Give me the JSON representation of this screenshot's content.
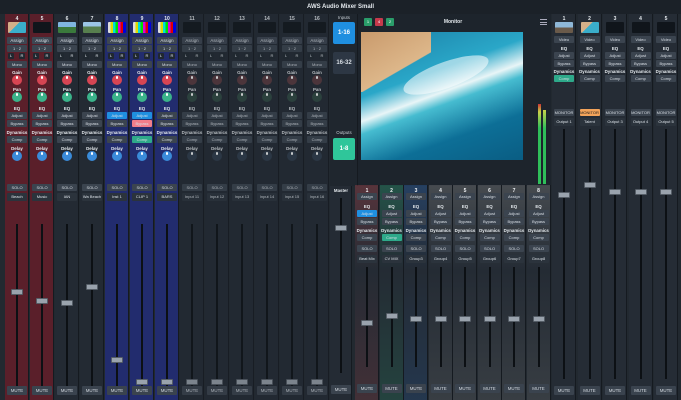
{
  "title": "AWS Audio Mixer Small",
  "colors": {
    "accent": "#2ea8d9",
    "red": "#d64553",
    "green": "#3ab38a",
    "blue": "#3a8bd9",
    "orange": "#f2a35a"
  },
  "common": {
    "assign": "Assign",
    "eq": "EQ",
    "adjust": "Adjust",
    "bypass": "Bypass",
    "dynamics": "Dynamics",
    "comp": "Comp",
    "gain": "Gain",
    "pan": "Pan",
    "delay": "Delay",
    "solo": "SOLO",
    "mute": "MUTE",
    "mono": "Mono",
    "l": "L",
    "r": "R",
    "route": "1 · 2",
    "video": "Video",
    "monitor": "MONITOR",
    "master": "Master",
    "outputs": "Outputs",
    "inputs_label": "Inputs"
  },
  "input_strips": [
    {
      "num": "4",
      "name": "Beach",
      "thumb": "beach",
      "bg": "#5a1f2a"
    },
    {
      "num": "5",
      "name": "Music",
      "thumb": "",
      "bg": "#5a1f2a"
    },
    {
      "num": "6",
      "name": "IAN",
      "thumb": "landscape",
      "bg": "#232a33"
    },
    {
      "num": "7",
      "name": "Wa Beach",
      "thumb": "landscape2",
      "bg": "#232a33"
    },
    {
      "num": "8",
      "name": "Inst 1",
      "thumb": "colorbars",
      "bg": "#222c6e"
    },
    {
      "num": "9",
      "name": "CLIP 1",
      "thumb": "colorbars",
      "bg": "#222c6e"
    },
    {
      "num": "10",
      "name": "BARS",
      "thumb": "colorbars",
      "bg": "#222c6e"
    },
    {
      "num": "11",
      "name": "Input 11",
      "thumb": "",
      "bg": "#232a33"
    },
    {
      "num": "12",
      "name": "Input 12",
      "thumb": "",
      "bg": "#232a33"
    },
    {
      "num": "13",
      "name": "Input 13",
      "thumb": "",
      "bg": "#232a33"
    },
    {
      "num": "14",
      "name": "Input 14",
      "thumb": "",
      "bg": "#232a33"
    },
    {
      "num": "15",
      "name": "Input 15",
      "thumb": "",
      "bg": "#232a33"
    },
    {
      "num": "16",
      "name": "Input 16",
      "thumb": "",
      "bg": "#232a33"
    }
  ],
  "bank": {
    "inputs_1_16": "1-16",
    "inputs_16_32": "16-32",
    "outputs_1_8": "1-8"
  },
  "monitor": {
    "label": "Monitor",
    "tags": [
      "1",
      "4",
      "2"
    ]
  },
  "mix_strips": [
    {
      "num": "1",
      "name": "Beat Mix",
      "color": "#c34a52"
    },
    {
      "num": "2",
      "name": "CV MIX",
      "color": "#2aa97a"
    },
    {
      "num": "3",
      "name": "Group3",
      "color": "#2f6fc4"
    },
    {
      "num": "4",
      "name": "Group4",
      "color": "#8f8f8f"
    },
    {
      "num": "5",
      "name": "Group5",
      "color": "#8f8f8f"
    },
    {
      "num": "6",
      "name": "Group6",
      "color": "#8f8f8f"
    },
    {
      "num": "7",
      "name": "Group7",
      "color": "#8f8f8f"
    },
    {
      "num": "8",
      "name": "Group8",
      "color": "#8f8f8f"
    }
  ],
  "output_strips": [
    {
      "num": "1",
      "name": "Output 1",
      "thumb": "monitor"
    },
    {
      "num": "2",
      "name": "Talent",
      "thumb": "beach"
    },
    {
      "num": "3",
      "name": "Output 3",
      "thumb": ""
    },
    {
      "num": "4",
      "name": "Output 4",
      "thumb": ""
    },
    {
      "num": "5",
      "name": "Output 5",
      "thumb": ""
    }
  ],
  "fader_levels": {
    "inputs": [
      0.58,
      0.52,
      0.51,
      0.61,
      0.14,
      0.0,
      0.0,
      0.0,
      0.0,
      0.0,
      0.0,
      0.0,
      0.0
    ],
    "master": 0.84,
    "mix": [
      0.47,
      0.54,
      0.51,
      0.51,
      0.51,
      0.51,
      0.51,
      0.51
    ],
    "outputs": [
      0.75,
      0.79,
      0.76,
      0.76,
      0.76
    ]
  }
}
